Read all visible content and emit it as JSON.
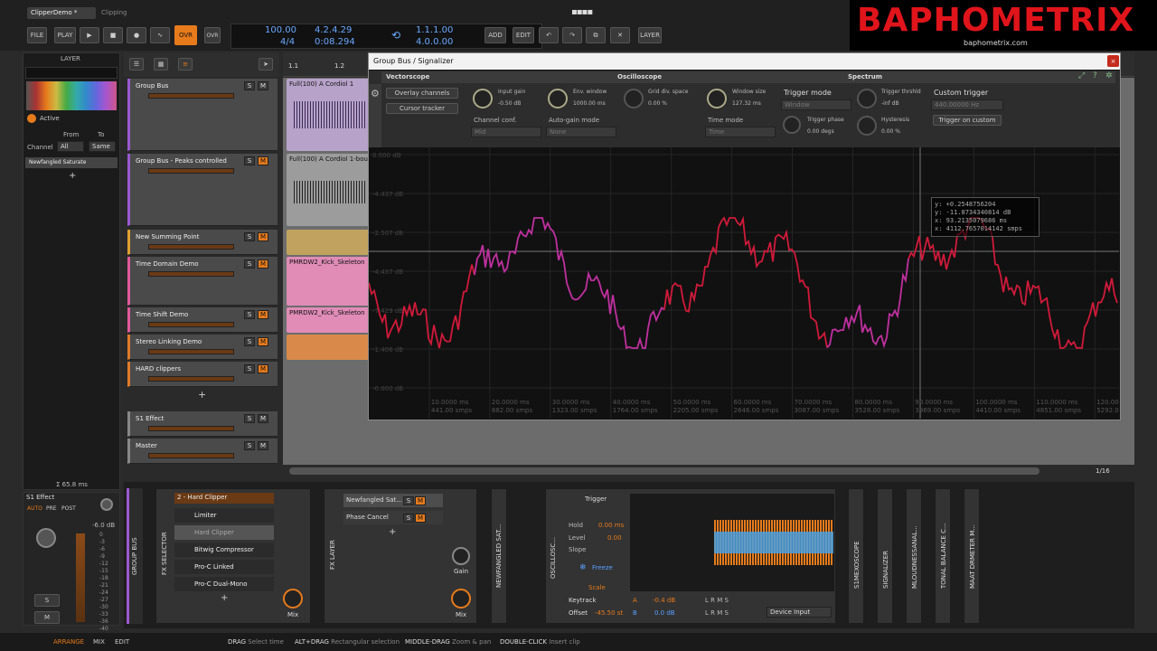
{
  "top": {
    "tab1": "ClipperDemo *",
    "tab2": "Clipping",
    "file": "FILE",
    "play": "PLAY",
    "ovr": "OVR",
    "tempo": "100.00",
    "sig": "4/4",
    "pos_bars": "4.2.4.29",
    "pos_time": "0:08.294",
    "loop_start": "1.1.1.00",
    "loop_len": "4.0.0.00",
    "add": "ADD",
    "edit": "EDIT",
    "layer": "LAYER"
  },
  "brand": {
    "name": "BAPHOMETRIX",
    "url": "baphometrix.com"
  },
  "inspector": {
    "title": "LAYER",
    "active": "Active",
    "from": "From",
    "to": "To",
    "channel": "Channel",
    "from_val": "All",
    "to_val": "Same",
    "device": "Newfangled Saturate",
    "latency": "Σ 65.8 ms",
    "effect_name": "S1 Effect",
    "auto": "AUTO",
    "pre": "PRE",
    "post": "POST",
    "db": "-6.0 dB",
    "s": "S",
    "m": "M",
    "meter_scale": [
      "0",
      "-3",
      "-6",
      "-9",
      "-12",
      "-15",
      "-18",
      "-21",
      "-24",
      "-27",
      "-30",
      "-33",
      "-36",
      "-40"
    ]
  },
  "tracks": [
    {
      "name": "Group Bus"
    },
    {
      "name": "Group Bus - Peaks controlled"
    },
    {
      "name": "New Summing Point"
    },
    {
      "name": "Time Domain Demo"
    },
    {
      "name": "Time Shift Demo"
    },
    {
      "name": "Stereo Linking Demo"
    },
    {
      "name": "HARD clippers"
    },
    {
      "name": "S1 Effect"
    },
    {
      "name": "Master"
    }
  ],
  "track_btn": {
    "s": "S",
    "m": "M"
  },
  "ruler": {
    "m1": "1.1",
    "m2": "1.2",
    "zoom": "1/16"
  },
  "clips": {
    "c1": "Full(100) A Cordiol 1",
    "c2": "Full(100) A Cordiol 1-boun",
    "c3": "PMRDW2_Kick_Skeleton",
    "c4": "PMRDW2_Kick_Skeleton"
  },
  "plugin": {
    "title": "Group Bus / Signalizer",
    "vectorscope": "Vectorscope",
    "oscilloscope": "Oscilloscope",
    "spectrum": "Spectrum",
    "overlay": "Overlay channels",
    "cursor": "Cursor tracker",
    "input_gain": "Input gain",
    "input_gain_val": "-0.50 dB",
    "env_window": "Env. window",
    "env_window_val": "1000.00 ms",
    "grid_div": "Grid div. space",
    "grid_div_val": "0.00 %",
    "channel_conf": "Channel conf.",
    "channel_conf_val": "Mid",
    "auto_gain": "Auto-gain mode",
    "auto_gain_val": "None",
    "window_size": "Window size",
    "window_size_val": "127.32 ms",
    "time_mode": "Time mode",
    "time_mode_val": "Time",
    "trigger_mode": "Trigger mode",
    "trigger_mode_val": "Window",
    "trigger_phase": "Trigger phase",
    "trigger_phase_val": "0.00 degs",
    "trigger_thr": "Trigger thrshld",
    "trigger_thr_val": "-inf dB",
    "hysteresis": "Hysteresis",
    "hysteresis_val": "0.00 %",
    "custom_trigger": "Custom trigger",
    "custom_trigger_val": "440.00000 Hz",
    "trigger_custom_btn": "Trigger on custom",
    "readout": [
      "y: +0.2548756204",
      "y: -11.8734340814 dB",
      "x: 93.2135079686 ms",
      "x: 4112.7657014142 smps"
    ],
    "x_ticks": [
      "10.0000 ms",
      "20.0000 ms",
      "30.0000 ms",
      "40.0000 ms",
      "50.0000 ms",
      "60.0000 ms",
      "70.0000 ms",
      "80.0000 ms",
      "90.0000 ms",
      "100.0000 ms",
      "110.0000 ms",
      "120.0000 ms"
    ],
    "x_ticks2": [
      "441.00 smps",
      "882.00 smps",
      "1323.00 smps",
      "1764.00 smps",
      "2205.00 smps",
      "2646.00 smps",
      "3087.00 smps",
      "3528.00 smps",
      "3969.00 smps",
      "4410.00 smps",
      "4851.00 smps",
      "5292.00 smps"
    ],
    "y_ticks": [
      "0.000 dB",
      "-4.437 dB",
      "-2.507 dB",
      "-4.437 dB",
      "-7.429 dB",
      "-1.406 dB",
      "-0.000 dB"
    ]
  },
  "devices": {
    "group_bus": "GROUP BUS",
    "fx_selector": "FX SELECTOR",
    "selector_head": "2 - Hard Clipper",
    "chain": [
      "Limiter",
      "Hard Clipper",
      "Bitwig Compressor",
      "Pro-C Linked",
      "Pro-C Dual-Mono"
    ],
    "mix": "Mix",
    "fx_layer": "FX LAYER",
    "layer1": "Newfangled Sat...",
    "layer2": "Phase Cancel",
    "gain": "Gain",
    "newfangled": "NEWFANGLED SAT...",
    "oscilloscope": "OSCILLOSC...",
    "trigger": "Trigger",
    "hold": "Hold",
    "hold_val": "0.00 ms",
    "level": "Level",
    "level_val": "0.00",
    "slope": "Slope",
    "freeze": "Freeze",
    "scale": "Scale",
    "keytrack": "Keytrack",
    "offset": "Offset",
    "offset_val": "-45.50 st",
    "a_val": "-0.4 dB",
    "b_val": "0.0 dB",
    "lrms": "L R M S",
    "device_input": "Device Input",
    "plugs": [
      "S1MEXOSCOPE",
      "SIGNALIZER",
      "MLOUDNESSANAL...",
      "TONAL BALANCE C...",
      "MAAT DRMETER M..."
    ]
  },
  "status": {
    "arrange": "ARRANGE",
    "mix": "MIX",
    "edit": "EDIT",
    "drag": "DRAG",
    "drag_h": "Select time",
    "altdrag": "ALT+DRAG",
    "altdrag_h": "Rectangular selection",
    "mid": "MIDDLE-DRAG",
    "mid_h": "Zoom & pan",
    "dbl": "DOUBLE-CLICK",
    "dbl_h": "Insert clip"
  }
}
